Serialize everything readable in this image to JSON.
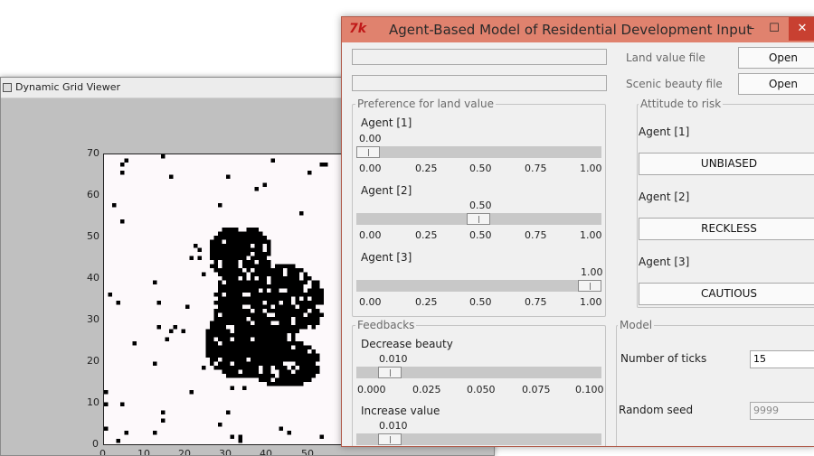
{
  "grid_viewer": {
    "title": "Dynamic Grid Viewer",
    "icon": "window-icon",
    "y_ticks": [
      "70",
      "60",
      "50",
      "40",
      "30",
      "20",
      "10",
      "0"
    ],
    "x_ticks": [
      "0",
      "10",
      "20",
      "30",
      "40",
      "50"
    ]
  },
  "dialog": {
    "title": "Agent-Based Model of Residential Development Input",
    "logo": "7k",
    "controls": {
      "minimize": "–",
      "maximize": "☐",
      "close": "✕"
    },
    "files": {
      "land_value_label": "Land value file",
      "land_value_value": "",
      "land_value_open": "Open",
      "scenic_label": "Scenic beauty file",
      "scenic_value": "",
      "scenic_open": "Open"
    },
    "preference": {
      "group_label": "Preference for land value",
      "scale": [
        "0.00",
        "0.25",
        "0.50",
        "0.75",
        "1.00"
      ],
      "agents": [
        {
          "label": "Agent [1]",
          "value_text": "0.00",
          "value": 0.0
        },
        {
          "label": "Agent [2]",
          "value_text": "0.50",
          "value": 0.5
        },
        {
          "label": "Agent [3]",
          "value_text": "1.00",
          "value": 1.0
        }
      ]
    },
    "risk": {
      "group_label": "Attitude to risk",
      "agents": [
        {
          "label": "Agent [1]",
          "button": "UNBIASED"
        },
        {
          "label": "Agent [2]",
          "button": "RECKLESS"
        },
        {
          "label": "Agent [3]",
          "button": "CAUTIOUS"
        }
      ]
    },
    "feedbacks": {
      "group_label": "Feedbacks",
      "decrease": {
        "label": "Decrease beauty",
        "value_text": "0.010",
        "value": 0.01
      },
      "scale": [
        "0.000",
        "0.025",
        "0.050",
        "0.075",
        "0.100"
      ],
      "increase": {
        "label": "Increase value",
        "value_text": "0.010",
        "value": 0.01
      }
    },
    "model": {
      "group_label": "Model",
      "ticks_label": "Number of ticks",
      "ticks_value": "15",
      "seed_label": "Random seed",
      "seed_value": "9999"
    }
  }
}
